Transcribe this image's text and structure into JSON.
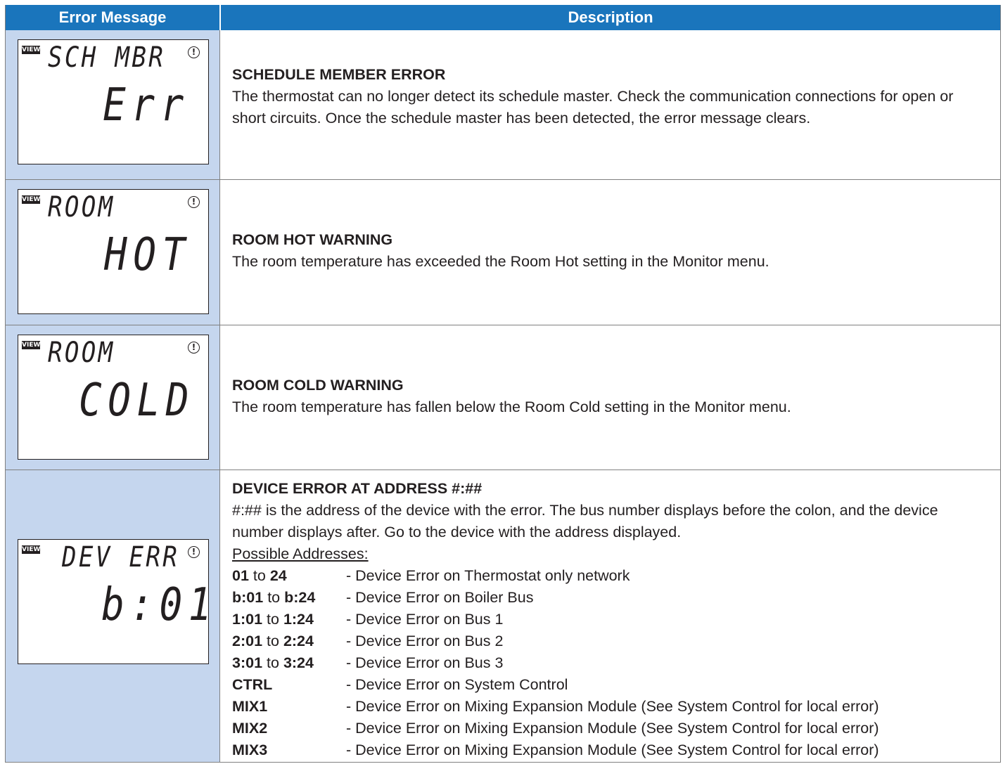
{
  "header": {
    "col1": "Error Message",
    "col2": "Description"
  },
  "rows": [
    {
      "lcd": {
        "view": "VIEW",
        "alert_icon": "!",
        "line1": "SCH MBR",
        "line2": "Err"
      },
      "title": "SCHEDULE MEMBER ERROR",
      "text": "The thermostat can no longer detect its schedule master. Check the communication connections for open or short circuits. Once the schedule master has been detected, the error message clears."
    },
    {
      "lcd": {
        "view": "VIEW",
        "alert_icon": "!",
        "line1": "ROOM",
        "line2": "HOT"
      },
      "title": "ROOM HOT WARNING",
      "text": "The room temperature has exceeded the Room Hot setting in the Monitor menu."
    },
    {
      "lcd": {
        "view": "VIEW",
        "alert_icon": "!",
        "line1": "ROOM",
        "line2": "COLD"
      },
      "title": "ROOM COLD WARNING",
      "text": "The room temperature has fallen below the Room Cold setting in the Monitor menu."
    },
    {
      "lcd": {
        "view": "VIEW",
        "alert_icon": "!",
        "line1": "DEV ERR",
        "line2": "b:01"
      },
      "title": "DEVICE ERROR AT ADDRESS #:##",
      "text": "#:## is the address of the device with the error. The bus number displays before the colon, and the device number displays after. Go to the device with the address displayed.",
      "addresses_heading": "Possible Addresses:",
      "addresses": [
        {
          "from": "01",
          "sep": "to",
          "to": "24",
          "desc": "- Device Error on Thermostat only network"
        },
        {
          "from": "b:01",
          "sep": "to",
          "to": "b:24",
          "desc": "- Device Error on Boiler Bus"
        },
        {
          "from": "1:01",
          "sep": "to",
          "to": "1:24",
          "desc": "- Device Error on Bus 1"
        },
        {
          "from": "2:01",
          "sep": "to",
          "to": "2:24",
          "desc": "- Device Error on Bus 2"
        },
        {
          "from": "3:01",
          "sep": "to",
          "to": "3:24",
          "desc": "- Device Error on Bus 3"
        },
        {
          "from": "CTRL",
          "sep": "",
          "to": "",
          "desc": "- Device Error on System Control"
        },
        {
          "from": "MIX1",
          "sep": "",
          "to": "",
          "desc": "- Device Error on Mixing Expansion Module (See System Control for local error)"
        },
        {
          "from": "MIX2",
          "sep": "",
          "to": "",
          "desc": "- Device Error on Mixing Expansion Module (See System Control for local error)"
        },
        {
          "from": "MIX3",
          "sep": "",
          "to": "",
          "desc": "- Device Error on Mixing Expansion Module (See System Control for local error)"
        }
      ]
    }
  ]
}
